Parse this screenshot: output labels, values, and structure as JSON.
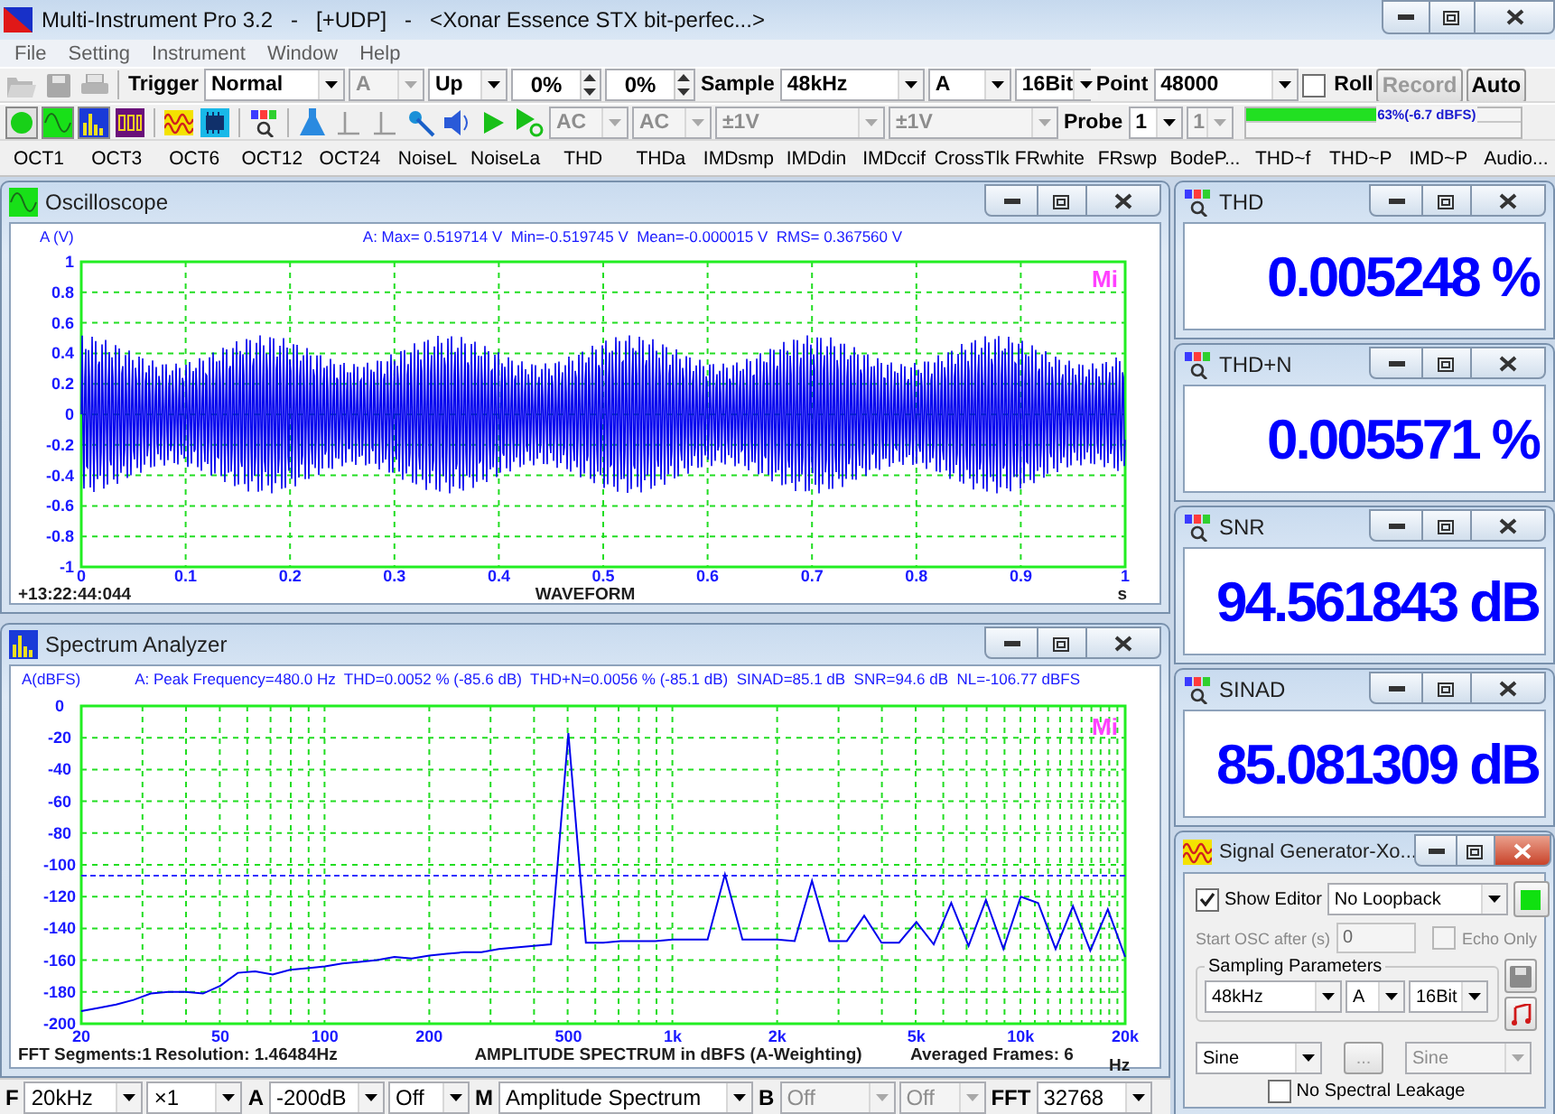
{
  "window": {
    "title": "Multi-Instrument Pro 3.2   -   [+UDP]   -   <Xonar Essence STX bit-perfec...>"
  },
  "menu": [
    "File",
    "Setting",
    "Instrument",
    "Window",
    "Help"
  ],
  "toolbar": {
    "items": [
      {
        "kind": "label",
        "text": "Trigger"
      },
      {
        "kind": "select",
        "value": "Normal",
        "disabled": false
      },
      {
        "kind": "select",
        "value": "A",
        "disabled": true
      },
      {
        "kind": "select",
        "value": "Up",
        "disabled": false
      },
      {
        "kind": "spin",
        "value": "0%"
      },
      {
        "kind": "spin",
        "value": "0%"
      },
      {
        "kind": "label",
        "text": "Sample"
      },
      {
        "kind": "select",
        "value": "48kHz",
        "disabled": false
      },
      {
        "kind": "select",
        "value": "A",
        "disabled": false
      },
      {
        "kind": "select",
        "value": "16Bit",
        "disabled": false
      },
      {
        "kind": "label",
        "text": "Point"
      },
      {
        "kind": "select",
        "value": "48000",
        "disabled": false
      },
      {
        "kind": "checkbox",
        "label": "Roll",
        "checked": false
      },
      {
        "kind": "button",
        "label": "Record",
        "disabled": true
      },
      {
        "kind": "button",
        "label": "Auto",
        "disabled": false
      }
    ]
  },
  "channel_bar": {
    "items": [
      {
        "kind": "select",
        "value": "AC",
        "disabled": true
      },
      {
        "kind": "select",
        "value": "AC",
        "disabled": true
      },
      {
        "kind": "select",
        "value": "±1V",
        "disabled": true
      },
      {
        "kind": "select",
        "value": "±1V",
        "disabled": true
      },
      {
        "kind": "label",
        "text": "Probe"
      },
      {
        "kind": "select",
        "value": "1",
        "disabled": false
      },
      {
        "kind": "select",
        "value": "1",
        "disabled": true
      }
    ],
    "meter": {
      "level": 0.51,
      "reading": "63%(-6.7 dBFS)"
    }
  },
  "analysis_buttons": [
    "OCT1",
    "OCT3",
    "OCT6",
    "OCT12",
    "OCT24",
    "NoiseL",
    "NoiseLa",
    "THD",
    "THDa",
    "IMDsmp",
    "IMDdin",
    "IMDccif",
    "CrossTlk",
    "FRwhite",
    "FRswp",
    "BodeP...",
    "THD~f",
    "THD~P",
    "IMD~P",
    "Audio..."
  ],
  "oscilloscope": {
    "title": "Oscilloscope",
    "y_unit": "A (V)",
    "stats": "A: Max= 0.519714 V  Min=-0.519745 V  Mean=-0.000015 V  RMS= 0.367560 V",
    "logo": "Mi",
    "y_tick_labels": [
      "1",
      "0.8",
      "0.6",
      "0.4",
      "0.2",
      "0",
      "-0.2",
      "-0.4",
      "-0.6",
      "-0.8",
      "-1"
    ],
    "x_tick_labels": [
      "0",
      "0.1",
      "0.2",
      "0.3",
      "0.4",
      "0.5",
      "0.6",
      "0.7",
      "0.8",
      "0.9",
      "1"
    ],
    "timestamp": "+13:22:44:044",
    "x_title": "WAVEFORM",
    "x_unit": "s"
  },
  "spectrum": {
    "title": "Spectrum Analyzer",
    "y_unit": "A(dBFS)",
    "stats": "A: Peak Frequency=480.0 Hz  THD=0.0052 % (-85.6 dB)  THD+N=0.0056 % (-85.1 dB)  SINAD=85.1 dB  SNR=94.6 dB  NL=-106.77 dBFS",
    "logo": "Mi",
    "chart_data": {
      "type": "line",
      "ylim": [
        -200,
        0
      ],
      "grid": true,
      "ref_lines": [
        {
          "axis": "y",
          "value": -106.77,
          "color": "#3030ff"
        }
      ],
      "categories": [
        "20",
        null,
        null,
        null,
        null,
        null,
        null,
        null,
        "50",
        null,
        null,
        null,
        null,
        null,
        "100",
        null,
        null,
        null,
        null,
        null,
        "200",
        null,
        null,
        null,
        null,
        null,
        null,
        null,
        "500",
        null,
        null,
        null,
        null,
        null,
        "1k",
        null,
        null,
        null,
        null,
        null,
        "2k",
        null,
        null,
        null,
        null,
        null,
        null,
        null,
        "5k",
        null,
        null,
        null,
        null,
        null,
        "10k",
        null,
        null,
        null,
        null,
        null,
        "20k"
      ],
      "yticks": [
        0,
        -20,
        -40,
        -60,
        -80,
        -100,
        -120,
        -140,
        -160,
        -180,
        -200
      ],
      "series": [
        {
          "color": "#0000ee",
          "values": [
            -192,
            -190,
            -188,
            -185,
            -181,
            -180,
            -180,
            -181,
            -176,
            -168,
            -167,
            -169,
            -166,
            -165,
            -164,
            -162,
            -161,
            -160,
            -158,
            -159,
            -157,
            -156,
            -155,
            -155,
            -153,
            -152,
            -151,
            -150,
            -17,
            -149,
            -149,
            -148,
            -148,
            -148,
            -147,
            -147,
            -147,
            -106,
            -147,
            -147,
            -147,
            -148,
            -110,
            -148,
            -148,
            -132,
            -149,
            -149,
            -136,
            -150,
            -124,
            -151,
            -122,
            -153,
            -120,
            -124,
            -153,
            -126,
            -154,
            -128,
            -158
          ]
        }
      ]
    },
    "segments": "FFT  Segments:1",
    "resolution": "Resolution: 1.46484Hz",
    "x_title": "AMPLITUDE SPECTRUM in dBFS (A-Weighting)",
    "frames": "Averaged Frames: 6",
    "x_unit": "Hz",
    "controls": [
      {
        "kind": "label",
        "text": "F"
      },
      {
        "kind": "select",
        "value": "20kHz",
        "disabled": false
      },
      {
        "kind": "select",
        "value": "×1",
        "disabled": false
      },
      {
        "kind": "label",
        "text": "A"
      },
      {
        "kind": "select",
        "value": "-200dB",
        "disabled": false
      },
      {
        "kind": "select",
        "value": "Off",
        "disabled": false
      },
      {
        "kind": "label",
        "text": "M"
      },
      {
        "kind": "select",
        "value": "Amplitude Spectrum",
        "disabled": false
      },
      {
        "kind": "label",
        "text": "B"
      },
      {
        "kind": "select",
        "value": "Off",
        "disabled": true
      },
      {
        "kind": "select",
        "value": "Off",
        "disabled": true
      },
      {
        "kind": "label",
        "text": "FFT"
      },
      {
        "kind": "select",
        "value": "32768",
        "disabled": false
      }
    ]
  },
  "meters": [
    {
      "title": "THD",
      "value": "0.005248 %"
    },
    {
      "title": "THD+N",
      "value": "0.005571 %"
    },
    {
      "title": "SNR",
      "value": "94.561843 dB"
    },
    {
      "title": "SINAD",
      "value": "85.081309 dB"
    }
  ],
  "signal_generator": {
    "title": "Signal Generator-Xo...",
    "show_editor": {
      "label": "Show Editor",
      "checked": true
    },
    "loopback": "No Loopback",
    "start_osc": {
      "label": "Start OSC after (s)",
      "value": "0",
      "disabled": true
    },
    "echo_only": {
      "label": "Echo Only",
      "checked": false,
      "disabled": true
    },
    "sampling": {
      "legend": "Sampling Parameters",
      "rate": "48kHz",
      "channel": "A",
      "bits": "16Bit"
    },
    "waveform_a": {
      "value": "Sine",
      "disabled": false
    },
    "more_button": {
      "label": "...",
      "disabled": true
    },
    "waveform_b": {
      "value": "Sine",
      "disabled": true
    },
    "no_leakage": {
      "label": "No Spectral Leakage",
      "checked": false
    }
  }
}
